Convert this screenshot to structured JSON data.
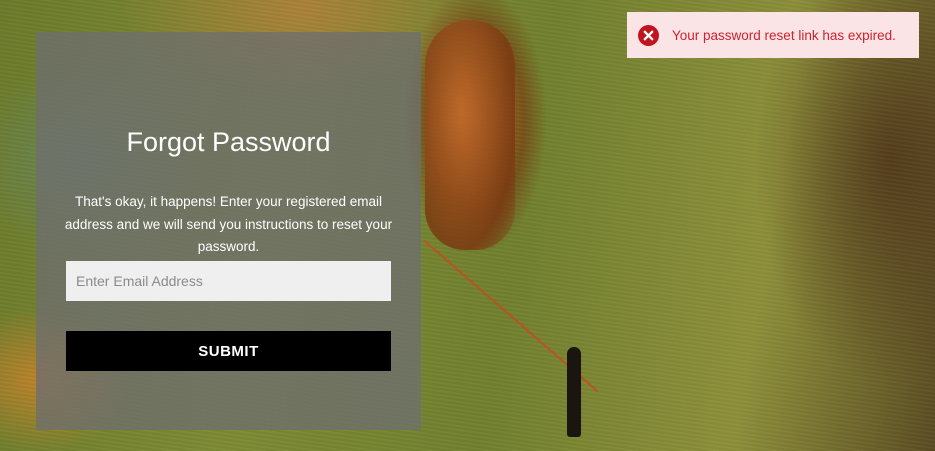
{
  "form": {
    "title": "Forgot Password",
    "description": "That's okay, it happens! Enter your registered email address and we will send you instructions to reset your password.",
    "email_placeholder": "Enter Email Address",
    "email_value": "",
    "submit_label": "SUBMIT"
  },
  "toast": {
    "type": "error",
    "icon": "error-circle-icon",
    "message": "Your password reset link has expired.",
    "background": "#fbe4e6",
    "text_color": "#d0212e"
  },
  "colors": {
    "panel_overlay": "rgba(110,110,110,0.78)",
    "button_bg": "#000000",
    "input_bg": "#efefef"
  }
}
